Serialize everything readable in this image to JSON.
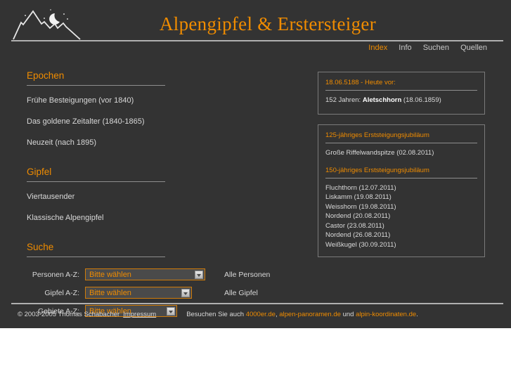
{
  "header": {
    "logo_icon": "mountain-moon-stars-icon",
    "title": "Alpengipfel & Erstersteiger",
    "nav": [
      {
        "label": "Index",
        "active": true
      },
      {
        "label": "Info",
        "active": false
      },
      {
        "label": "Suchen",
        "active": false
      },
      {
        "label": "Quellen",
        "active": false
      }
    ]
  },
  "sidebar": {
    "epochen": {
      "heading": "Epochen",
      "items": [
        "Frühe Besteigungen (vor 1840)",
        "Das goldene Zeitalter (1840-1865)",
        "Neuzeit (nach 1895)"
      ]
    },
    "gipfel": {
      "heading": "Gipfel",
      "items": [
        "Viertausender",
        "Klassische Alpengipfel"
      ]
    },
    "suche": {
      "heading": "Suche",
      "rows": [
        {
          "label": "Personen A-Z:",
          "select_value": "Bitte wählen",
          "link": "Alle Personen"
        },
        {
          "label": "Gipfel A-Z:",
          "select_value": "Bitte wählen",
          "link": "Alle Gipfel"
        },
        {
          "label": "Gebiete A-Z:",
          "select_value": "Bitte wählen",
          "link": ""
        }
      ]
    }
  },
  "panels": {
    "today": {
      "title": "18.06.5188 - Heute vor:",
      "entry_prefix": "152 Jahren: ",
      "entry_name": "Aletschhorn",
      "entry_suffix": " (18.06.1859)"
    },
    "anniversaries": [
      {
        "title": "125-jähriges Erststeigungsjubiläum",
        "entries": [
          "Große Riffelwandspitze (02.08.2011)"
        ]
      },
      {
        "title": "150-jähriges Erststeigungsjubiläum",
        "entries": [
          "Fluchthorn (12.07.2011)",
          "Liskamm (19.08.2011)",
          "Weisshorn (19.08.2011)",
          "Nordend (20.08.2011)",
          "Castor (23.08.2011)",
          "Nordend (26.08.2011)",
          "Weißkugel (30.09.2011)"
        ]
      }
    ]
  },
  "footer": {
    "copyright": "© 2003-2005 Thomas Schabacher",
    "imprint": "Impressum",
    "visit_prefix": "Besuchen Sie auch ",
    "link1": "4000er.de",
    "sep1": ", ",
    "link2": "alpen-panoramen.de",
    "sep2": " und ",
    "link3": "alpin-koordinaten.de",
    "period": "."
  },
  "colors": {
    "background": "#333333",
    "accent": "#f08c00",
    "text": "#d8d8d8",
    "rule": "#b0b0b0"
  }
}
